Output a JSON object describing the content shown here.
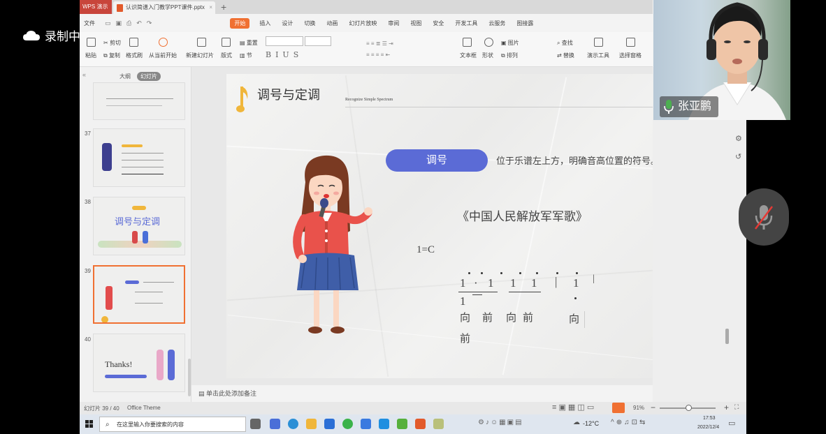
{
  "recording": {
    "label": "录制中"
  },
  "tabs": {
    "app": "WPS 演示",
    "doc": "认识简谱入门教学PPT课件.pptx"
  },
  "menu": {
    "file": "文件",
    "items": [
      "开始",
      "插入",
      "设计",
      "切换",
      "动画",
      "幻灯片放映",
      "审阅",
      "视图",
      "安全",
      "开发工具",
      "云服务",
      "图接露"
    ],
    "active": "开始"
  },
  "ribbon": {
    "paste": "粘贴",
    "cut": "剪切",
    "copy": "复制",
    "format_painter": "格式刷",
    "from_current": "从当前开始",
    "new_slide": "新建幻灯片",
    "layout": "版式",
    "reset": "重置",
    "section": "节",
    "textbox": "文本框",
    "shape": "形状",
    "picture": "图片",
    "arrange": "排列",
    "find": "查找",
    "replace": "替换",
    "presentation_tools": "演示工具",
    "select_pane": "选择窗格"
  },
  "left_panel": {
    "tabs": [
      "大纲",
      "幻灯片"
    ],
    "active_tab": "幻灯片",
    "thumbnails": [
      {
        "num": "37"
      },
      {
        "num": "38",
        "title": "调号与定调"
      },
      {
        "num": "39",
        "selected": true
      },
      {
        "num": "40",
        "title": "Thanks!"
      }
    ]
  },
  "slide": {
    "title": "调号与定调",
    "subtitle": "Recognize Simple Spectrum",
    "pill": "调号",
    "description": "位于乐谱左上方，明确音高位置的符号。",
    "song": "《中国人民解放军军歌》",
    "key": "1=C",
    "notation": {
      "line1": [
        "1",
        "·",
        "1",
        "1",
        "1",
        "|",
        "1",
        "|"
      ],
      "line2": "1",
      "lyrics_line1": [
        "向",
        "前",
        "向",
        "前",
        "向"
      ],
      "lyrics_line2": "前"
    }
  },
  "notes_bar": {
    "placeholder": "单击此处添加备注"
  },
  "status": {
    "slide_info": "幻灯片 39 / 40",
    "theme": "Office Theme",
    "zoom": "91%"
  },
  "taskbar": {
    "search_placeholder": "在这里输入你要搜索的内容",
    "weather": "-12°C",
    "time": "17:53",
    "date": "2022/12/4"
  },
  "webcam": {
    "name": "张亚鹏"
  },
  "colors": {
    "accent": "#f07032",
    "pill": "#5b6bd6",
    "tab_wps": "#c8453b"
  }
}
